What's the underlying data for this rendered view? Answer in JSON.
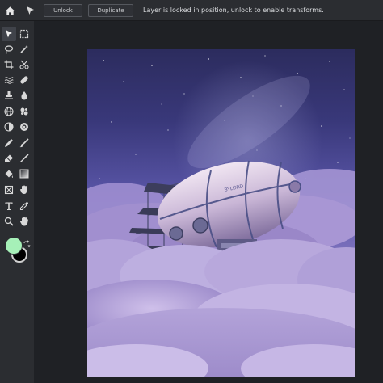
{
  "toolbar_top": {
    "unlock_label": "Unlock",
    "duplicate_label": "Duplicate",
    "message": "Layer is locked in position, unlock to enable transforms."
  },
  "tools": [
    "move",
    "marquee",
    "lasso",
    "magic-wand",
    "crop",
    "slice",
    "heal",
    "brush",
    "clone-stamp",
    "blur-drop",
    "globe",
    "blob",
    "dodge",
    "sponge",
    "pencil",
    "smudge",
    "eraser",
    "paint",
    "fill",
    "gradient",
    "frame",
    "puppet",
    "text",
    "eyedropper",
    "zoom",
    "hand"
  ],
  "colors": {
    "foreground": "#a6f0b8",
    "background": "#000000"
  },
  "canvas": {
    "airship_lettering": "BYLORD"
  }
}
